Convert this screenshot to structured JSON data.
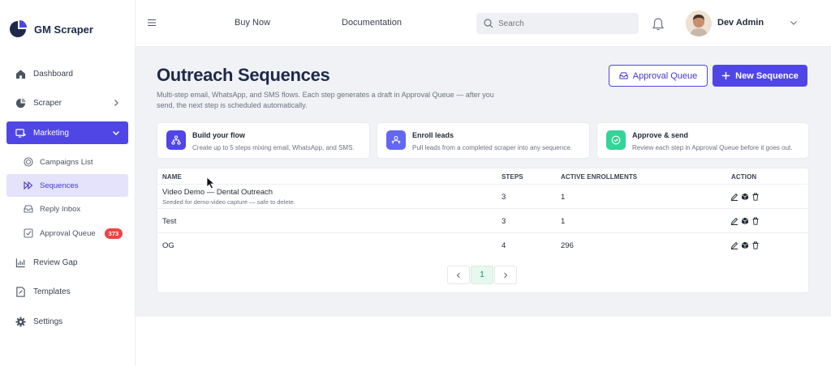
{
  "app": {
    "name": "GM Scraper"
  },
  "sidebar": {
    "items": [
      {
        "label": "Dashboard",
        "icon": "home-icon"
      },
      {
        "label": "Scraper",
        "icon": "scraper-icon"
      },
      {
        "label": "Marketing",
        "icon": "marketing-icon"
      },
      {
        "label": "Review Gap",
        "icon": "chart-icon"
      },
      {
        "label": "Templates",
        "icon": "template-icon"
      },
      {
        "label": "Settings",
        "icon": "gear-icon"
      }
    ],
    "marketing_sub": [
      {
        "label": "Campaigns List",
        "icon": "target-icon"
      },
      {
        "label": "Sequences",
        "icon": "sequence-icon"
      },
      {
        "label": "Reply Inbox",
        "icon": "inbox-icon"
      },
      {
        "label": "Approval Queue",
        "icon": "checkbox-icon",
        "badge": "373"
      }
    ]
  },
  "topbar": {
    "links": [
      "Buy Now",
      "Documentation"
    ],
    "search_placeholder": "Search",
    "user_name": "Dev Admin"
  },
  "page": {
    "title": "Outreach Sequences",
    "description": "Multi-step email, WhatsApp, and SMS flows. Each step generates a draft in Approval Queue — after you send, the next step is scheduled automatically.",
    "approval_button": "Approval Queue",
    "new_button": "New Sequence"
  },
  "cards": [
    {
      "title": "Build your flow",
      "text": "Create up to 5 steps mixing email, WhatsApp, and SMS.",
      "color": "#4f46e5"
    },
    {
      "title": "Enroll leads",
      "text": "Pull leads from a completed scraper into any sequence.",
      "color": "#6366f1"
    },
    {
      "title": "Approve & send",
      "text": "Review each step in Approval Queue before it goes out.",
      "color": "#34d399"
    }
  ],
  "table": {
    "headers": [
      "NAME",
      "STEPS",
      "ACTIVE ENROLLMENTS",
      "ACTION"
    ],
    "rows": [
      {
        "name": "Video Demo — Dental Outreach",
        "sub": "Seeded for demo-video capture — safe to delete.",
        "steps": "3",
        "active": "1"
      },
      {
        "name": "Test",
        "sub": "",
        "steps": "3",
        "active": "1"
      },
      {
        "name": "OG",
        "sub": "",
        "steps": "4",
        "active": "296"
      }
    ]
  },
  "pagination": {
    "current": "1"
  },
  "colors": {
    "accent": "#4f46e5",
    "badge": "#ef4444",
    "page_bg": "#f1f2f6"
  }
}
